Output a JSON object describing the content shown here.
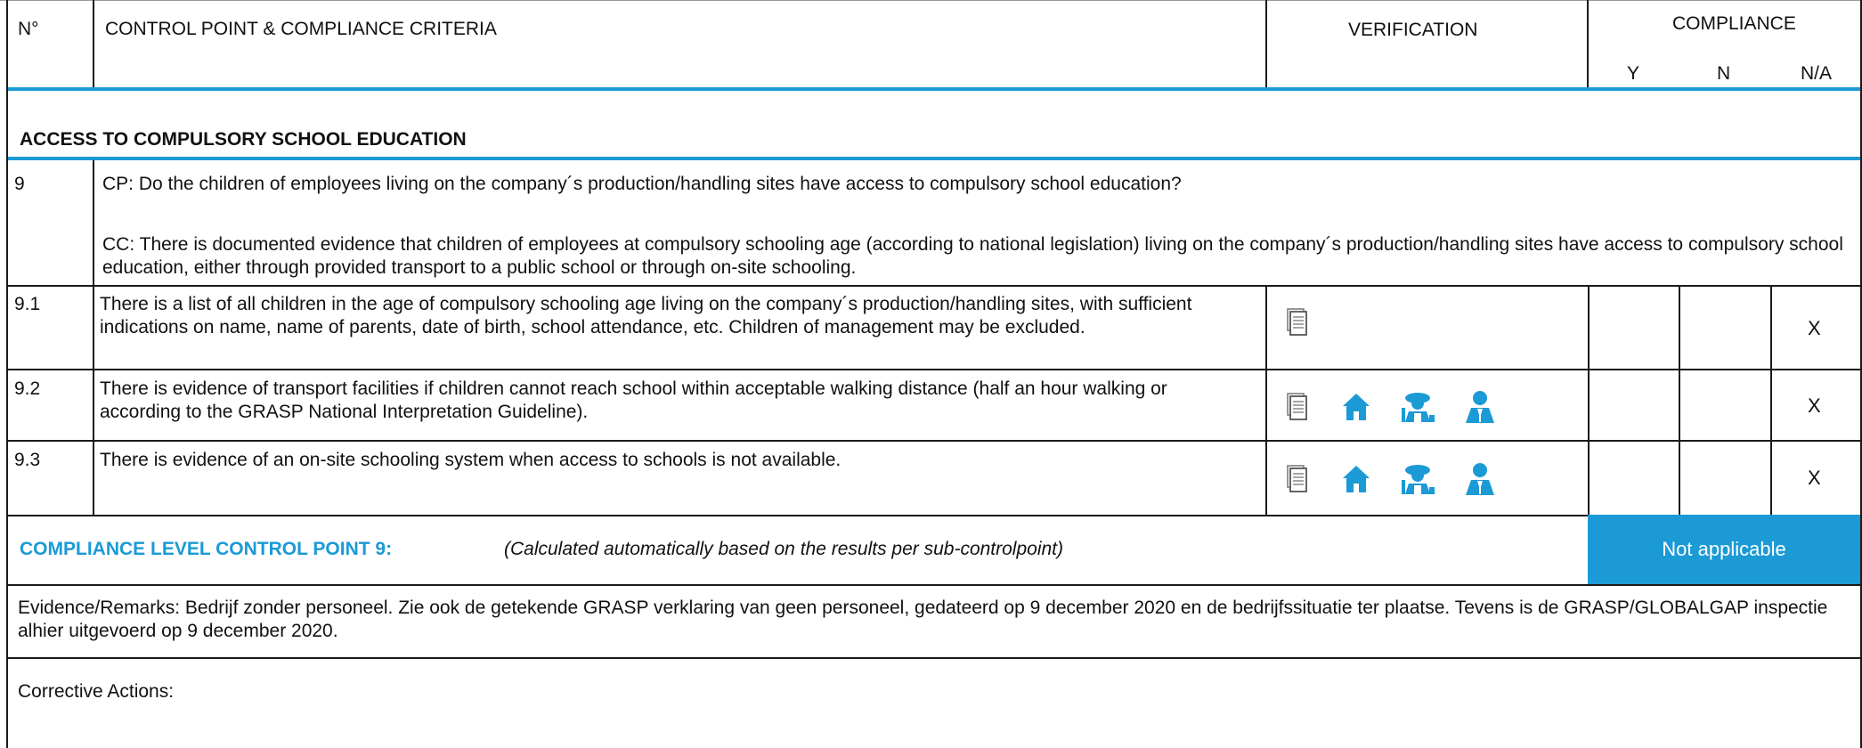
{
  "header": {
    "no": "N°",
    "control_point": "CONTROL POINT & COMPLIANCE CRITERIA",
    "verification": "VERIFICATION",
    "compliance": "COMPLIANCE",
    "y": "Y",
    "n": "N",
    "na": "N/A"
  },
  "section_title": "ACCESS TO COMPULSORY SCHOOL EDUCATION",
  "cp9": {
    "number": "9",
    "cp": "CP: Do the children of employees living on the company´s production/handling sites have access to compulsory school education?",
    "cc": "CC: There is documented evidence that children of employees at compulsory schooling age (according to national legislation) living on the company´s production/handling sites have access to compulsory school education, either through provided transport to a public school or through on-site schooling."
  },
  "rows": [
    {
      "number": "9.1",
      "text": "There is a list of all children in the age of compulsory schooling age living on the  company´s production/handling sites, with sufficient indications on name, name of parents, date of birth, school attendance, etc. Children of management may be excluded.",
      "verification_icons": [
        "document-icon"
      ],
      "y": "",
      "n": "",
      "na": "X"
    },
    {
      "number": "9.2",
      "text": "There is evidence of transport facilities if children cannot reach school within acceptable walking distance (half an hour walking or according to the GRASP National Interpretation Guideline).",
      "verification_icons": [
        "document-icon",
        "house-icon",
        "worker-icon",
        "manager-icon"
      ],
      "y": "",
      "n": "",
      "na": "X"
    },
    {
      "number": "9.3",
      "text": "There is evidence of an on-site schooling system when access to schools is not available.",
      "verification_icons": [
        "document-icon",
        "house-icon",
        "worker-icon",
        "manager-icon"
      ],
      "y": "",
      "n": "",
      "na": "X"
    }
  ],
  "compliance_level": {
    "label": "COMPLIANCE LEVEL CONTROL POINT 9:",
    "note": "(Calculated automatically based on the results per sub-controlpoint)",
    "result": "Not applicable"
  },
  "evidence": "Evidence/Remarks: Bedrijf zonder personeel. Zie ook de getekende GRASP verklaring van geen personeel, gedateerd op 9 december 2020 en de bedrijfssituatie ter plaatse. Tevens is de GRASP/GLOBALGAP inspectie alhier uitgevoerd op 9 december 2020.",
  "corrective_actions": "Corrective Actions:",
  "colors": {
    "accent": "#1b9ad6",
    "border": "#1a1a1a"
  }
}
